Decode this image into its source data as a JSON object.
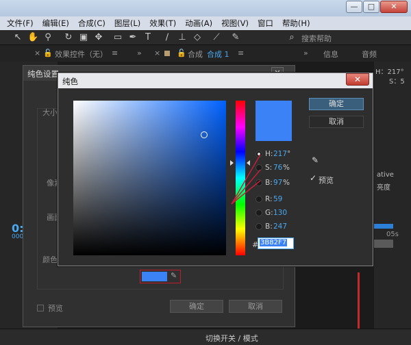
{
  "window": {
    "controls": {
      "minimize": "—",
      "maximize": "□",
      "close": "✕"
    }
  },
  "menu": [
    "文件(F)",
    "编辑(E)",
    "合成(C)",
    "图层(L)",
    "效果(T)",
    "动画(A)",
    "视图(V)",
    "窗口",
    "帮助(H)"
  ],
  "toolbar": {
    "search_label": "搜索帮助"
  },
  "panels": {
    "effects_tab": "效果控件（无）",
    "comp_tab_prefix": "合成",
    "comp_tab_name": "合成 1",
    "info_tab": "信息",
    "audio_tab": "音频",
    "info_h": "H：217°",
    "info_s": "S：5",
    "right_labels": [
      "ative",
      "亮度"
    ]
  },
  "solid_dialog": {
    "title": "纯色设置",
    "close": "✕",
    "label_size": "大小",
    "label_pixels": "像素",
    "label_frame": "画面",
    "label_color": "颜色",
    "preview_label": "预览",
    "ok_label": "确定",
    "cancel_label": "取消",
    "swatch_color": "#3b82f7"
  },
  "timeline": {
    "time": "0:0",
    "frames": "0000",
    "right_timecode": "05s"
  },
  "color_picker": {
    "title": "纯色",
    "close": "✕",
    "ok_label": "确定",
    "cancel_label": "取消",
    "preview_label": "预览",
    "preview_checked": "✓",
    "current_color": "#3b82f7",
    "fields": {
      "H": {
        "label": "H:",
        "value": "217",
        "unit": "°"
      },
      "S": {
        "label": "S:",
        "value": "76",
        "unit": "%"
      },
      "B": {
        "label": "B:",
        "value": "97",
        "unit": "%"
      },
      "R": {
        "label": "R:",
        "value": "59"
      },
      "G": {
        "label": "G:",
        "value": "130"
      },
      "B2": {
        "label": "B:",
        "value": "247"
      }
    },
    "hex_hash": "#",
    "hex_value": "3B82F7"
  },
  "status_bar": {
    "label": "切换开关 / 模式"
  }
}
